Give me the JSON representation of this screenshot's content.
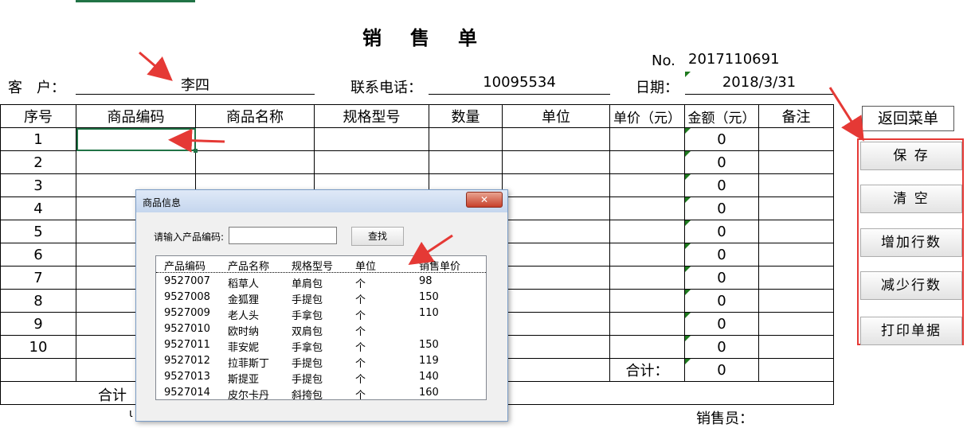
{
  "sheet": {
    "title": "销　售　单",
    "no_label": "No.",
    "no_value": "2017110691",
    "customer_label": "客　户：",
    "customer_value": "李四",
    "phone_label": "联系电话：",
    "phone_value": "10095534",
    "date_label": "日期：",
    "date_value": "2018/3/31",
    "columns": [
      "序号",
      "商品编码",
      "商品名称",
      "规格型号",
      "数量",
      "单位",
      "单价（元）",
      "金额（元）",
      "备注"
    ],
    "rows": [
      {
        "n": "1",
        "amount": "0"
      },
      {
        "n": "2",
        "amount": "0"
      },
      {
        "n": "3",
        "amount": "0"
      },
      {
        "n": "4",
        "amount": "0"
      },
      {
        "n": "5",
        "amount": "0"
      },
      {
        "n": "6",
        "amount": "0"
      },
      {
        "n": "7",
        "amount": "0"
      },
      {
        "n": "8",
        "amount": "0"
      },
      {
        "n": "9",
        "amount": "0"
      },
      {
        "n": "10",
        "amount": "0"
      }
    ],
    "subtotal_label": "合计：",
    "subtotal_value": "0",
    "total_label": "合计",
    "salesperson_label": "销售员：",
    "partial_text": "ι"
  },
  "buttons": {
    "return_menu": "返回菜单",
    "save": "保 存",
    "clear": "清 空",
    "add_rows": "增加行数",
    "remove_rows": "减少行数",
    "print": "打印单据"
  },
  "dialog": {
    "title": "商品信息",
    "close_glyph": "✕",
    "input_label": "请输入产品编码:",
    "input_value": "",
    "search_button": "查找",
    "headers": [
      "产品编码",
      "产品名称",
      "规格型号",
      "单位",
      "销售单价"
    ],
    "items": [
      {
        "code": "9527007",
        "name": "稻草人",
        "spec": "单肩包",
        "unit": "个",
        "price": "98"
      },
      {
        "code": "9527008",
        "name": "金狐狸",
        "spec": "手提包",
        "unit": "个",
        "price": "150"
      },
      {
        "code": "9527009",
        "name": "老人头",
        "spec": "手拿包",
        "unit": "个",
        "price": "110"
      },
      {
        "code": "9527010",
        "name": "欧时纳",
        "spec": "双肩包",
        "unit": "个",
        "price": ""
      },
      {
        "code": "9527011",
        "name": "菲安妮",
        "spec": "手拿包",
        "unit": "个",
        "price": "150"
      },
      {
        "code": "9527012",
        "name": "拉菲斯丁",
        "spec": "手提包",
        "unit": "个",
        "price": "119"
      },
      {
        "code": "9527013",
        "name": "斯提亚",
        "spec": "手提包",
        "unit": "个",
        "price": "140"
      },
      {
        "code": "9527014",
        "name": "皮尔卡丹",
        "spec": "斜挎包",
        "unit": "个",
        "price": "160"
      }
    ]
  },
  "colors": {
    "annotation_red": "#e53935",
    "selection_green": "#217346"
  }
}
